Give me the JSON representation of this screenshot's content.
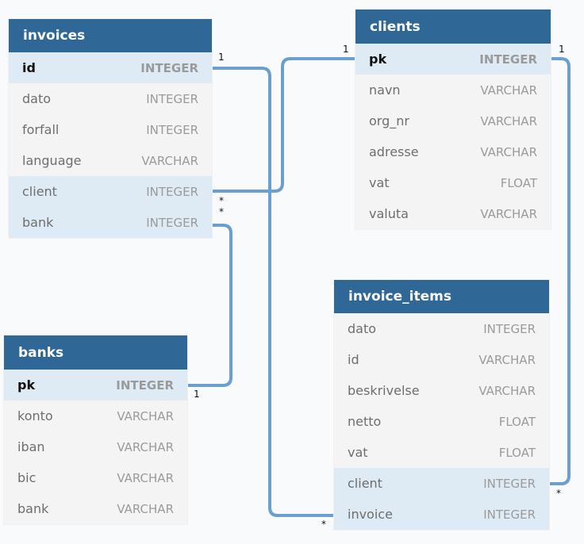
{
  "colors": {
    "header": "#2f6796",
    "key_row": "#deebf4",
    "row": "#f4f4f4",
    "connector": "#6a9fcf"
  },
  "tables": {
    "invoices": {
      "title": "invoices",
      "columns": [
        {
          "name": "id",
          "type": "INTEGER",
          "pk": true
        },
        {
          "name": "dato",
          "type": "INTEGER"
        },
        {
          "name": "forfall",
          "type": "INTEGER"
        },
        {
          "name": "language",
          "type": "VARCHAR"
        },
        {
          "name": "client",
          "type": "INTEGER",
          "fk": true
        },
        {
          "name": "bank",
          "type": "INTEGER",
          "fk": true
        }
      ]
    },
    "clients": {
      "title": "clients",
      "columns": [
        {
          "name": "pk",
          "type": "INTEGER",
          "pk": true
        },
        {
          "name": "navn",
          "type": "VARCHAR"
        },
        {
          "name": "org_nr",
          "type": "VARCHAR"
        },
        {
          "name": "adresse",
          "type": "VARCHAR"
        },
        {
          "name": "vat",
          "type": "FLOAT"
        },
        {
          "name": "valuta",
          "type": "VARCHAR"
        }
      ]
    },
    "invoice_items": {
      "title": "invoice_items",
      "columns": [
        {
          "name": "dato",
          "type": "INTEGER"
        },
        {
          "name": "id",
          "type": "VARCHAR"
        },
        {
          "name": "beskrivelse",
          "type": "VARCHAR"
        },
        {
          "name": "netto",
          "type": "FLOAT"
        },
        {
          "name": "vat",
          "type": "FLOAT"
        },
        {
          "name": "client",
          "type": "INTEGER",
          "fk": true
        },
        {
          "name": "invoice",
          "type": "INTEGER",
          "fk": true
        }
      ]
    },
    "banks": {
      "title": "banks",
      "columns": [
        {
          "name": "pk",
          "type": "INTEGER",
          "pk": true
        },
        {
          "name": "konto",
          "type": "VARCHAR"
        },
        {
          "name": "iban",
          "type": "VARCHAR"
        },
        {
          "name": "bic",
          "type": "VARCHAR"
        },
        {
          "name": "bank",
          "type": "VARCHAR"
        }
      ]
    }
  },
  "relations": [
    {
      "from": "invoices.id",
      "to": "invoice_items.invoice",
      "from_card": "1",
      "to_card": "*"
    },
    {
      "from": "clients.pk",
      "to": "invoices.client",
      "from_card": "1",
      "to_card": "*"
    },
    {
      "from": "banks.pk",
      "to": "invoices.bank",
      "from_card": "1",
      "to_card": "*"
    },
    {
      "from": "clients.pk",
      "to": "invoice_items.client",
      "from_card": "1",
      "to_card": "*"
    }
  ]
}
